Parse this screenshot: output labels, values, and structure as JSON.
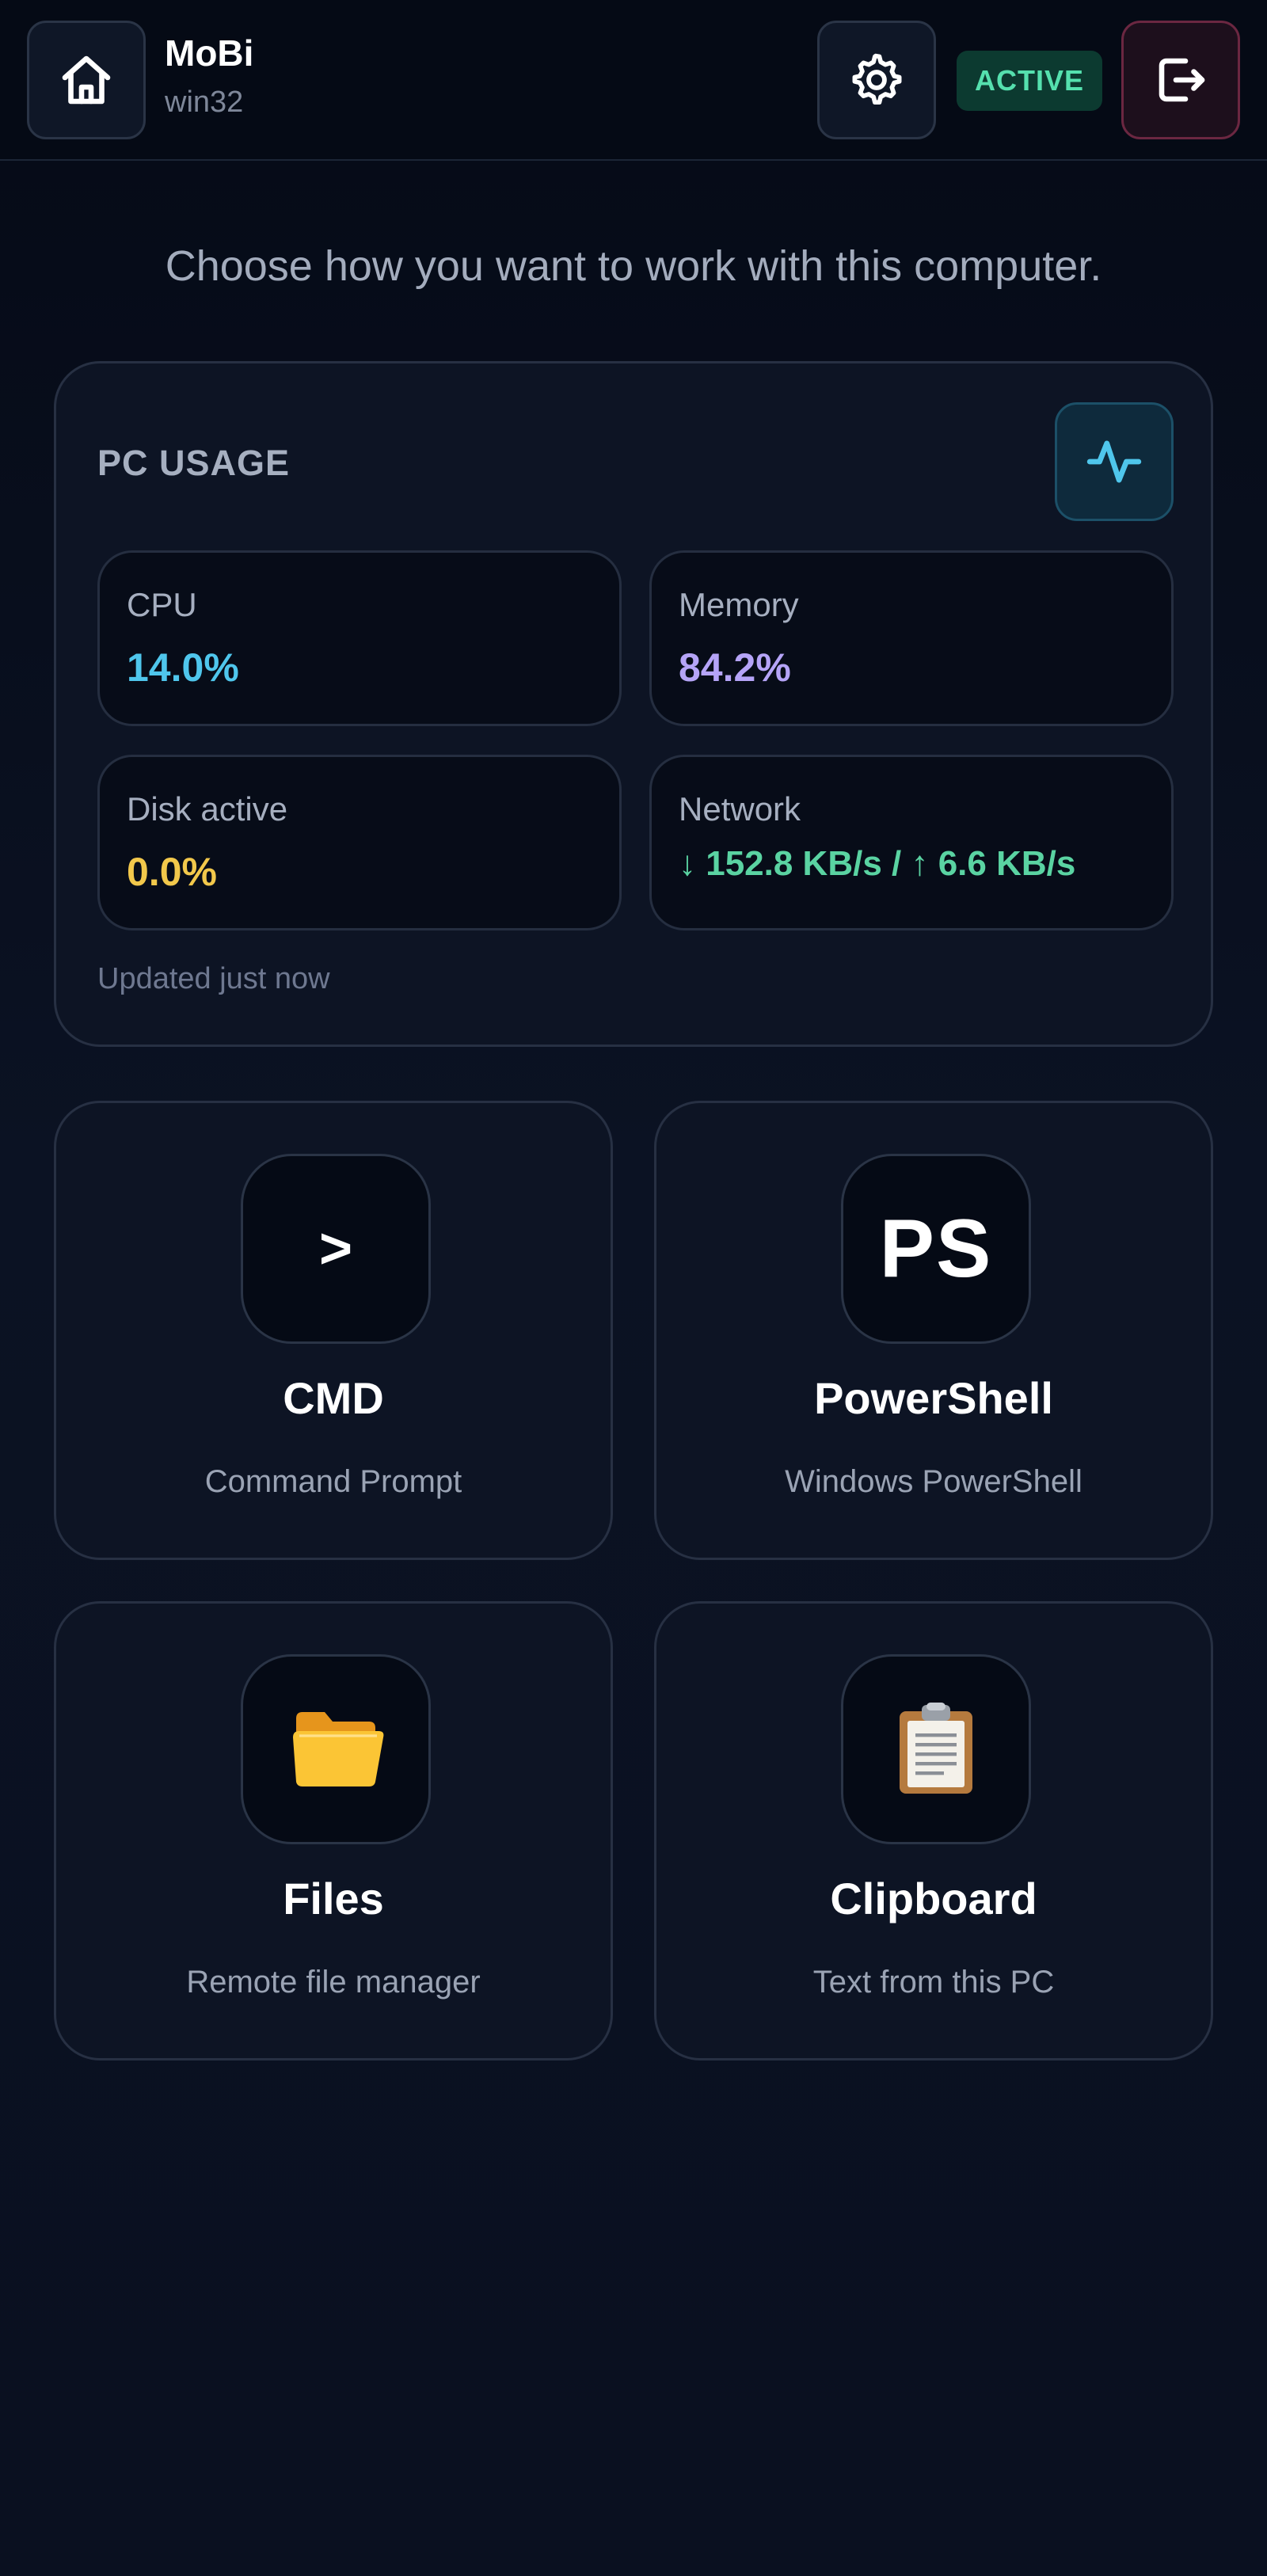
{
  "header": {
    "app_name": "MoBi",
    "platform": "win32",
    "status": "ACTIVE",
    "icons": {
      "home": "home-icon",
      "settings": "gear-icon",
      "logout": "logout-icon"
    }
  },
  "tagline": "Choose how you want to work with this computer.",
  "usage": {
    "title": "PC USAGE",
    "icon": "activity-pulse-icon",
    "stats": {
      "cpu": {
        "label": "CPU",
        "value": "14.0%",
        "color": "#4fc6ec"
      },
      "memory": {
        "label": "Memory",
        "value": "84.2%",
        "color": "#b5a4f7"
      },
      "disk": {
        "label": "Disk active",
        "value": "0.0%",
        "color": "#f2c84b"
      },
      "network": {
        "label": "Network",
        "value": "↓ 152.8 KB/s / ↑ 6.6 KB/s",
        "color": "#5ad3a2"
      }
    },
    "updated": "Updated just now"
  },
  "tools": {
    "cmd": {
      "glyph": ">",
      "title": "CMD",
      "subtitle": "Command Prompt"
    },
    "powershell": {
      "glyph": "PS",
      "title": "PowerShell",
      "subtitle": "Windows PowerShell"
    },
    "files": {
      "icon": "folder-icon",
      "title": "Files",
      "subtitle": "Remote file manager"
    },
    "clipboard": {
      "icon": "clipboard-icon",
      "title": "Clipboard",
      "subtitle": "Text from this PC"
    }
  },
  "colors": {
    "background": "#060b18",
    "card": "#0d1424",
    "accent_active": "#55e0ae",
    "logout_border": "#6b2741"
  }
}
